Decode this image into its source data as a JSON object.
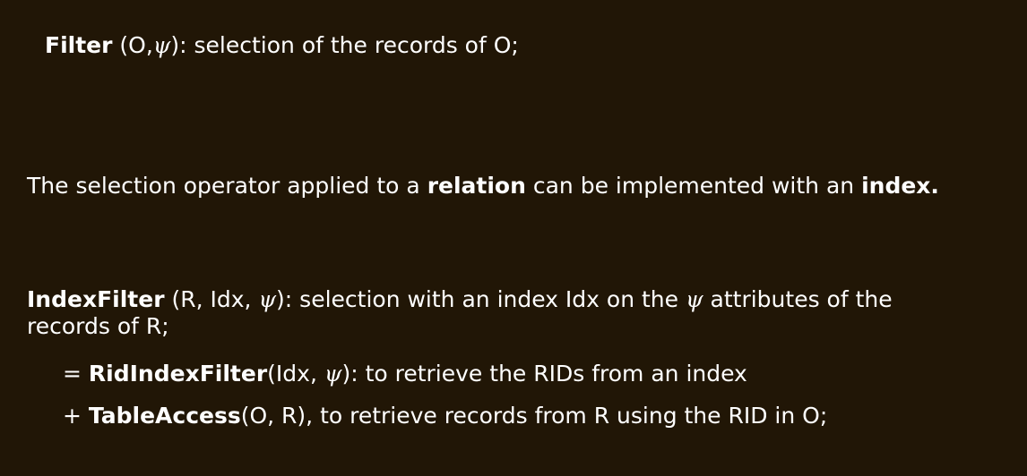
{
  "slide": {
    "filter_line": {
      "name": "Filter",
      "open": " (O,",
      "psi": "ψ",
      "rest": "): selection of the records of O;"
    },
    "selection_line": {
      "t1": "The selection  operator applied to a ",
      "relation": "relation",
      "t2": " can be implemented with an ",
      "index": "index",
      "t3": "."
    },
    "indexfilter_line": {
      "name": "IndexFilter",
      "open": " (R, Idx, ",
      "psi": "ψ",
      "mid": "): selection with an index Idx on the ",
      "psi2": "ψ",
      "rest": " attributes of the",
      "cont": "records of R;"
    },
    "rid_line": {
      "prefix": "= ",
      "name": "RidIndexFilter",
      "open": "(Idx, ",
      "psi": "ψ",
      "rest": "):  to retrieve the RIDs from an index"
    },
    "table_line": {
      "prefix": "+ ",
      "name": "TableAccess",
      "rest": "(O, R), to retrieve records from R using the RID in O;"
    }
  }
}
